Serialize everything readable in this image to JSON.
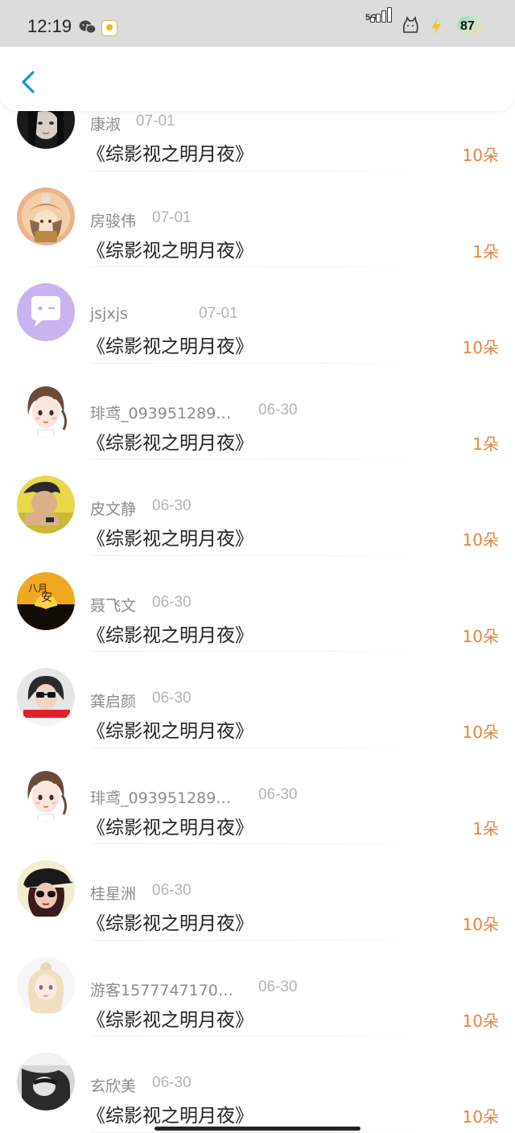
{
  "status_bar": {
    "time": "12:19",
    "network": "5G",
    "battery": "87",
    "icons": [
      "wechat-icon",
      "app-notification-icon",
      "signal-5g-icon",
      "cat-icon",
      "charging-bolt-icon",
      "battery-icon"
    ]
  },
  "nav": {
    "back_icon": "chevron-left-icon"
  },
  "colors": {
    "accent": "#1296db",
    "count": "#e8833a",
    "name": "#8b8b8b",
    "date": "#b4b4b4"
  },
  "entries": [
    {
      "name": "康淑",
      "date": "07-01",
      "title": "《综影视之明月夜》",
      "count": "10朵",
      "avatar": "dark-hair-girl"
    },
    {
      "name": "房骏伟",
      "date": "07-01",
      "title": "《综影视之明月夜》",
      "count": "1朵",
      "avatar": "anime-girl-hat"
    },
    {
      "name": "jsjxjs",
      "date": "07-01",
      "title": "《综影视之明月夜》",
      "count": "10朵",
      "avatar": "purple-chat-bubble"
    },
    {
      "name": "琲鸢_093951289…",
      "date": "06-30",
      "title": "《综影视之明月夜》",
      "count": "1朵",
      "avatar": "cartoon-girl"
    },
    {
      "name": "皮文静",
      "date": "06-30",
      "title": "《综影视之明月夜》",
      "count": "10朵",
      "avatar": "boy-yellow"
    },
    {
      "name": "聂飞文",
      "date": "06-30",
      "title": "《综影视之明月夜》",
      "count": "10朵",
      "avatar": "sunset-calligraphy"
    },
    {
      "name": "龚启颜",
      "date": "06-30",
      "title": "《综影视之明月夜》",
      "count": "10朵",
      "avatar": "girl-sunglasses-red"
    },
    {
      "name": "琲鸢_093951289…",
      "date": "06-30",
      "title": "《综影视之明月夜》",
      "count": "1朵",
      "avatar": "cartoon-girl"
    },
    {
      "name": "桂星洲",
      "date": "06-30",
      "title": "《综影视之明月夜》",
      "count": "10朵",
      "avatar": "girl-black-cap"
    },
    {
      "name": "游客1577747170…",
      "date": "06-30",
      "title": "《综影视之明月夜》",
      "count": "10朵",
      "avatar": "blonde-doll"
    },
    {
      "name": "玄欣美",
      "date": "06-30",
      "title": "《综影视之明月夜》",
      "count": "10朵",
      "avatar": "grey-portrait"
    }
  ]
}
